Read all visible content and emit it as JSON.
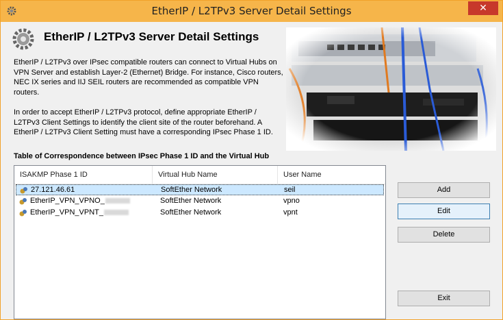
{
  "window": {
    "title": "EtherIP / L2TPv3 Server Detail Settings",
    "close_glyph": "✕"
  },
  "header": {
    "title": "EtherIP / L2TPv3 Server Detail Settings",
    "icon": "gear-icon"
  },
  "description": {
    "para1": "EtherIP / L2TPv3 over IPsec compatible routers can connect to Virtual Hubs on VPN Server and establish Layer-2 (Ethernet) Bridge. For instance, Cisco routers, NEC IX series and IIJ SEIL routers are recommended as compatible VPN routers.",
    "para2": "In order to accept EtherIP / L2TPv3 protocol, define appropriate EtherIP / L2TPv3 Client Settings to identify the client site of the router beforehand. A EtherIP / L2TPv3 Client Setting must have a corresponding IPsec Phase 1 ID."
  },
  "table": {
    "label": "Table of Correspondence between IPsec Phase 1 ID and the Virtual Hub",
    "columns": [
      "ISAKMP Phase 1 ID",
      "Virtual Hub Name",
      "User Name"
    ],
    "rows": [
      {
        "id": "27.121.46.61",
        "hub": "SoftEther Network",
        "user": "seil"
      },
      {
        "id": "EtherIP_VPN_VPNO_",
        "hub": "SoftEther Network",
        "user": "vpno"
      },
      {
        "id": "EtherIP_VPN_VPNT_",
        "hub": "SoftEther Network",
        "user": "vpnt"
      }
    ]
  },
  "buttons": {
    "add": "Add",
    "edit": "Edit",
    "delete": "Delete",
    "exit": "Exit"
  },
  "colors": {
    "titlebar": "#f6b54a",
    "close": "#c7382b",
    "selection": "#cce8ff"
  }
}
